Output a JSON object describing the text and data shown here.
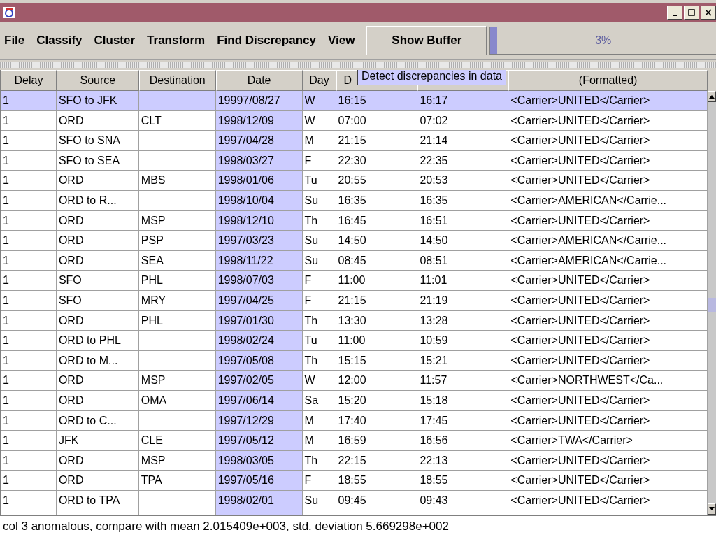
{
  "menu": [
    "File",
    "Classify",
    "Cluster",
    "Transform",
    "Find Discrepancy",
    "View"
  ],
  "show_buffer": "Show Buffer",
  "progress": {
    "level": 0.03,
    "label": "3%"
  },
  "tooltip": "Detect discrepancies in data",
  "table": {
    "columns": [
      {
        "label": "Delay",
        "selected": false
      },
      {
        "label": "Source",
        "selected": false
      },
      {
        "label": "Destination",
        "selected": false
      },
      {
        "label": "Date",
        "selected": true
      },
      {
        "label": "Day",
        "selected": false
      },
      {
        "label": "D",
        "selected": false
      },
      {
        "selected": false
      },
      {
        "label": "(Formatted)",
        "selected": false
      }
    ],
    "rows": [
      {
        "selected": true,
        "cells": [
          "1",
          "SFO to JFK",
          "",
          "19997/08/27",
          "W",
          "16:15",
          "16:17",
          "<Carrier>UNITED</Carrier>"
        ]
      },
      {
        "selected": false,
        "cells": [
          "1",
          "ORD",
          "CLT",
          "1998/12/09",
          "W",
          "07:00",
          "07:02",
          "<Carrier>UNITED</Carrier>"
        ]
      },
      {
        "selected": false,
        "cells": [
          "1",
          "SFO to SNA",
          "",
          "1997/04/28",
          "M",
          "21:15",
          "21:14",
          "<Carrier>UNITED</Carrier>"
        ]
      },
      {
        "selected": false,
        "cells": [
          "1",
          "SFO to SEA",
          "",
          "1998/03/27",
          "F",
          "22:30",
          "22:35",
          "<Carrier>UNITED</Carrier>"
        ]
      },
      {
        "selected": false,
        "cells": [
          "1",
          "ORD",
          "MBS",
          "1998/01/06",
          "Tu",
          "20:55",
          "20:53",
          "<Carrier>UNITED</Carrier>"
        ]
      },
      {
        "selected": false,
        "cells": [
          "1",
          "ORD to R...",
          "",
          "1998/10/04",
          "Su",
          "16:35",
          "16:35",
          "<Carrier>AMERICAN</Carrie..."
        ]
      },
      {
        "selected": false,
        "cells": [
          "1",
          "ORD",
          "MSP",
          "1998/12/10",
          "Th",
          "16:45",
          "16:51",
          "<Carrier>UNITED</Carrier>"
        ]
      },
      {
        "selected": false,
        "cells": [
          "1",
          "ORD",
          "PSP",
          "1997/03/23",
          "Su",
          "14:50",
          "14:50",
          "<Carrier>AMERICAN</Carrie..."
        ]
      },
      {
        "selected": false,
        "cells": [
          "1",
          "ORD",
          "SEA",
          "1998/11/22",
          "Su",
          "08:45",
          "08:51",
          "<Carrier>AMERICAN</Carrie..."
        ]
      },
      {
        "selected": false,
        "cells": [
          "1",
          "SFO",
          "PHL",
          "1998/07/03",
          "F",
          "11:00",
          "11:01",
          "<Carrier>UNITED</Carrier>"
        ]
      },
      {
        "selected": false,
        "cells": [
          "1",
          "SFO",
          "MRY",
          "1997/04/25",
          "F",
          "21:15",
          "21:19",
          "<Carrier>UNITED</Carrier>"
        ]
      },
      {
        "selected": false,
        "cells": [
          "1",
          "ORD",
          "PHL",
          "1997/01/30",
          "Th",
          "13:30",
          "13:28",
          "<Carrier>UNITED</Carrier>"
        ]
      },
      {
        "selected": false,
        "cells": [
          "1",
          "ORD to PHL",
          "",
          "1998/02/24",
          "Tu",
          "11:00",
          "10:59",
          "<Carrier>UNITED</Carrier>"
        ]
      },
      {
        "selected": false,
        "cells": [
          "1",
          "ORD to M...",
          "",
          "1997/05/08",
          "Th",
          "15:15",
          "15:21",
          "<Carrier>UNITED</Carrier>"
        ]
      },
      {
        "selected": false,
        "cells": [
          "1",
          "ORD",
          "MSP",
          "1997/02/05",
          "W",
          "12:00",
          "11:57",
          "<Carrier>NORTHWEST</Ca..."
        ]
      },
      {
        "selected": false,
        "cells": [
          "1",
          "ORD",
          "OMA",
          "1997/06/14",
          "Sa",
          "15:20",
          "15:18",
          "<Carrier>UNITED</Carrier>"
        ]
      },
      {
        "selected": false,
        "cells": [
          "1",
          "ORD to C...",
          "",
          "1997/12/29",
          "M",
          "17:40",
          "17:45",
          "<Carrier>UNITED</Carrier>"
        ]
      },
      {
        "selected": false,
        "cells": [
          "1",
          "JFK",
          "CLE",
          "1997/05/12",
          "M",
          "16:59",
          "16:56",
          "<Carrier>TWA</Carrier>"
        ]
      },
      {
        "selected": false,
        "cells": [
          "1",
          "ORD",
          "MSP",
          "1998/03/05",
          "Th",
          "22:15",
          "22:13",
          "<Carrier>UNITED</Carrier>"
        ]
      },
      {
        "selected": false,
        "cells": [
          "1",
          "ORD",
          "TPA",
          "1997/05/16",
          "F",
          "18:55",
          "18:55",
          "<Carrier>UNITED</Carrier>"
        ]
      },
      {
        "selected": false,
        "cells": [
          "1",
          "ORD to TPA",
          "",
          "1998/02/01",
          "Su",
          "09:45",
          "09:43",
          "<Carrier>UNITED</Carrier>"
        ]
      }
    ]
  },
  "status": "col 3 anomalous, compare with mean 2.015409e+003, std. deviation 5.669298e+002"
}
